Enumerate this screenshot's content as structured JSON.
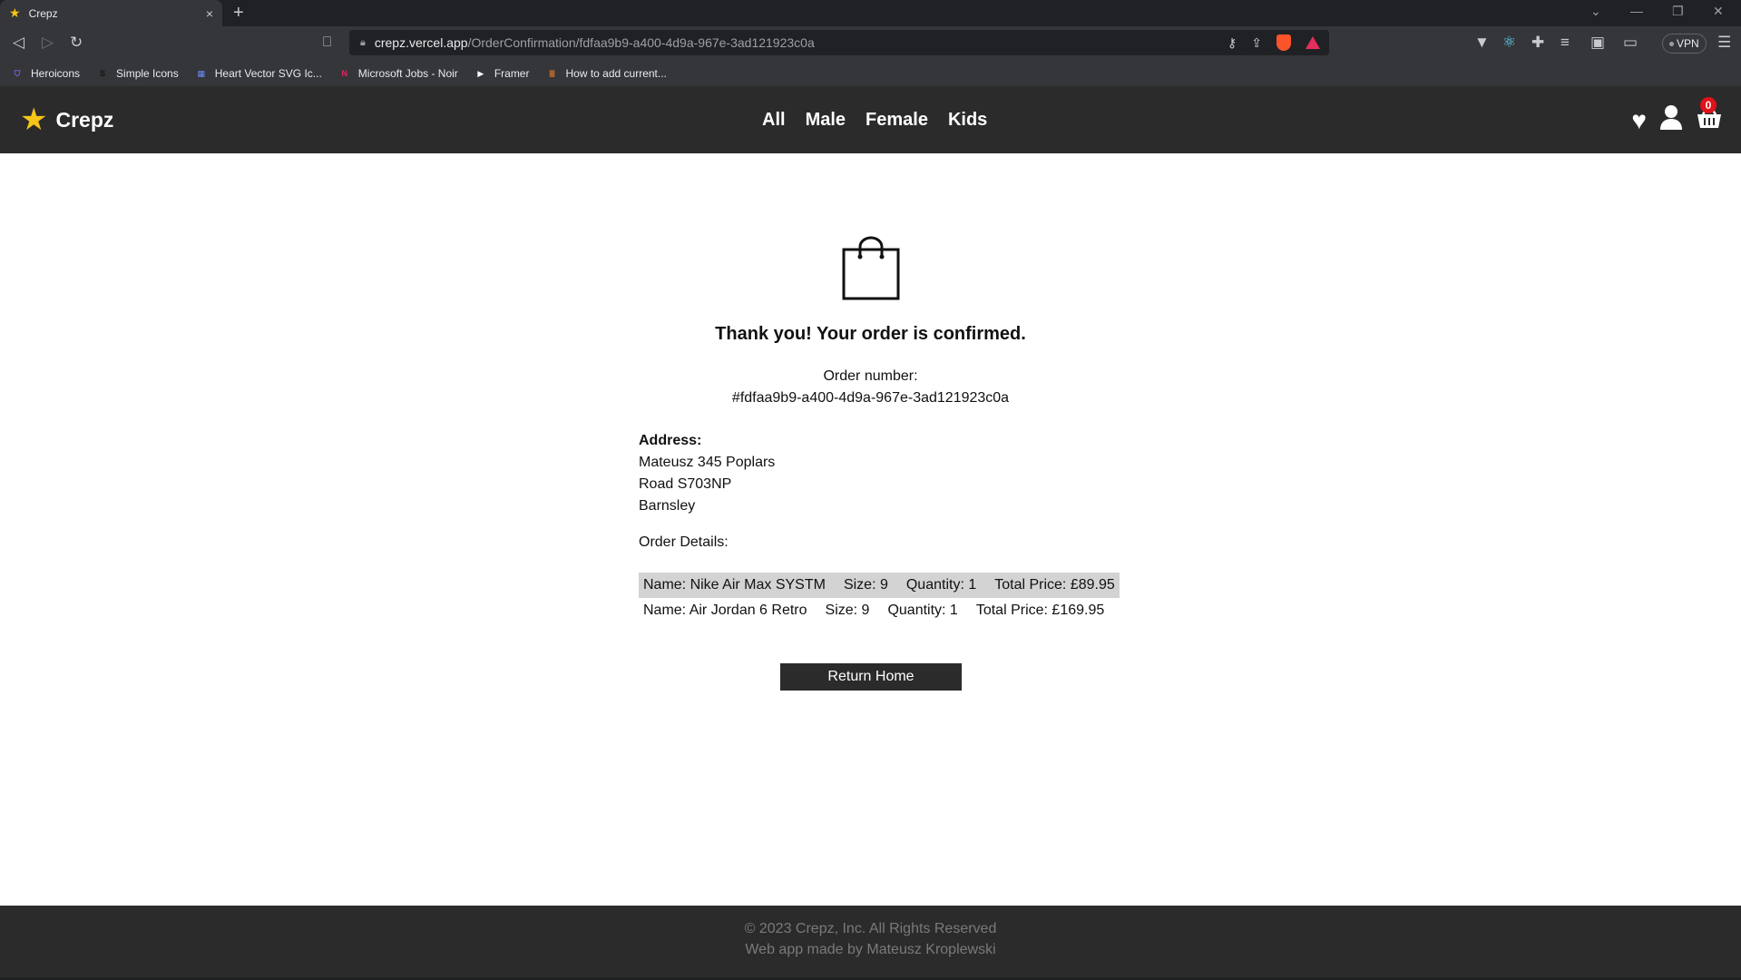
{
  "browser": {
    "tab_title": "Crepz",
    "tab_close": "×",
    "new_tab": "+",
    "url_host": "crepz.vercel.app",
    "url_path": "/OrderConfirmation/fdfaa9b9-a400-4d9a-967e-3ad121923c0a",
    "vpn_label": "VPN",
    "bookmarks": [
      {
        "label": "Heroicons",
        "icon": "shield-icon",
        "color": "#8b5cf6"
      },
      {
        "label": "Simple Icons",
        "icon": "simpleicons-icon",
        "color": "#111111"
      },
      {
        "label": "Heart Vector SVG Ic...",
        "icon": "svgrepo-icon",
        "color": "#6d8cf0"
      },
      {
        "label": "Microsoft Jobs - Noir",
        "icon": "noir-icon",
        "color": "#e0245e"
      },
      {
        "label": "Framer",
        "icon": "framer-icon",
        "color": "#ffffff"
      },
      {
        "label": "How to add current...",
        "icon": "stackoverflow-icon",
        "color": "#f48024"
      }
    ]
  },
  "header": {
    "brand": "Crepz",
    "nav": [
      "All",
      "Male",
      "Female",
      "Kids"
    ],
    "basket_count": "0"
  },
  "confirmation": {
    "heading": "Thank you! Your order is confirmed.",
    "order_number_label": "Order number:",
    "order_number": "#fdfaa9b9-a400-4d9a-967e-3ad121923c0a",
    "address_label": "Address:",
    "address_lines": [
      "Mateusz 345 Poplars",
      "Road S703NP",
      "Barnsley"
    ],
    "order_details_label": "Order Details:",
    "items": [
      {
        "name": "Name: Nike Air Max SYSTM",
        "size": "Size: 9",
        "quantity": "Quantity: 1",
        "total": "Total Price: £89.95"
      },
      {
        "name": "Name: Air Jordan 6 Retro",
        "size": "Size: 9",
        "quantity": "Quantity: 1",
        "total": "Total Price: £169.95"
      }
    ],
    "return_button": "Return Home"
  },
  "footer": {
    "copyright": "© 2023 Crepz, Inc. All Rights Reserved",
    "credit": "Web app made by Mateusz Kroplewski"
  },
  "colors": {
    "header_bg": "#2b2b2b",
    "accent_star": "#f5c518",
    "badge": "#e0121a",
    "row_alt": "#d3d3d3"
  }
}
